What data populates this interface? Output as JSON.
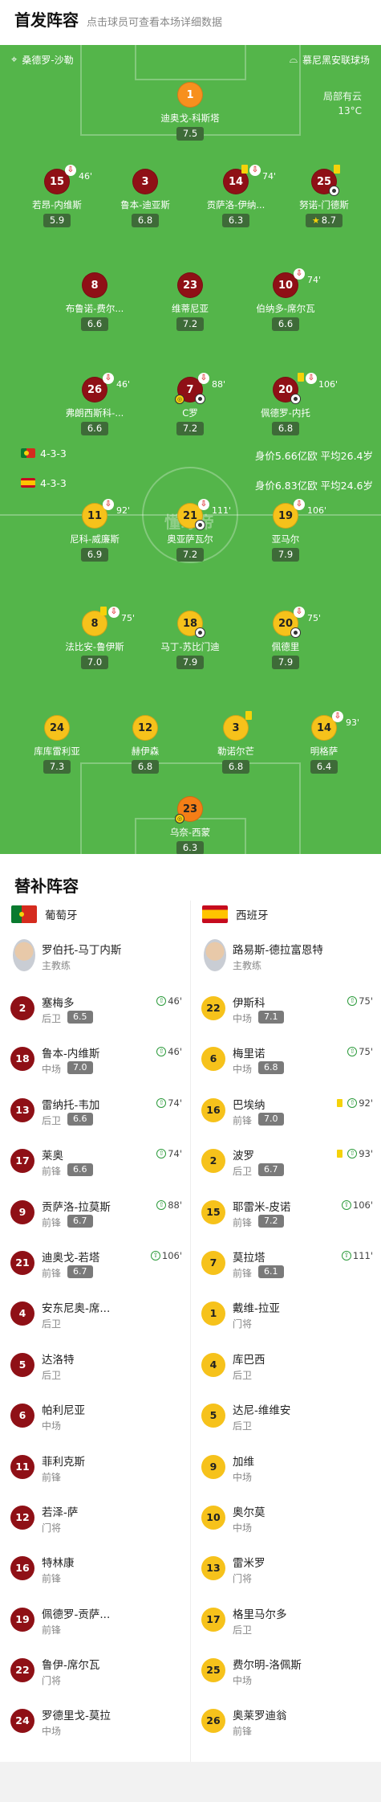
{
  "header": {
    "title": "首发阵容",
    "subtitle": "点击球员可查看本场详细数据"
  },
  "pitch": {
    "referee_label": "桑德罗-沙勒",
    "stadium_label": "慕尼黑安联球场",
    "weather": "局部有云",
    "temperature": "13°C",
    "watermark": "懂球帝",
    "portugal": {
      "formation": "4-3-3",
      "value": "身价5.66亿欧  平均26.4岁"
    },
    "spain": {
      "formation": "4-3-3",
      "value": "身价6.83亿欧  平均24.6岁"
    }
  },
  "portugal_players": [
    {
      "num": "1",
      "name": "迪奥戈-科斯塔",
      "rating": "7.5"
    },
    {
      "num": "15",
      "name": "若昂-内维斯",
      "rating": "5.9",
      "sub": "46'"
    },
    {
      "num": "3",
      "name": "鲁本-迪亚斯",
      "rating": "6.8"
    },
    {
      "num": "14",
      "name": "贡萨洛-伊纳...",
      "rating": "6.3",
      "sub": "74'"
    },
    {
      "num": "25",
      "name": "努诺-门德斯",
      "rating": "8.7"
    },
    {
      "num": "8",
      "name": "布鲁诺-费尔...",
      "rating": "6.6"
    },
    {
      "num": "23",
      "name": "维蒂尼亚",
      "rating": "7.2"
    },
    {
      "num": "10",
      "name": "伯纳多-席尔瓦",
      "rating": "6.6",
      "sub": "74'"
    },
    {
      "num": "26",
      "name": "弗朗西斯科-...",
      "rating": "6.6",
      "sub": "46'"
    },
    {
      "num": "7",
      "name": "C罗",
      "rating": "7.2",
      "sub": "88'"
    },
    {
      "num": "20",
      "name": "佩德罗-内托",
      "rating": "6.8",
      "sub": "106'"
    }
  ],
  "spain_players": [
    {
      "num": "11",
      "name": "尼科-威廉斯",
      "rating": "6.9",
      "sub": "92'"
    },
    {
      "num": "21",
      "name": "奥亚萨瓦尔",
      "rating": "7.2",
      "sub": "111'"
    },
    {
      "num": "19",
      "name": "亚马尔",
      "rating": "7.9",
      "sub": "106'"
    },
    {
      "num": "8",
      "name": "法比安-鲁伊斯",
      "rating": "7.0",
      "sub": "75'"
    },
    {
      "num": "18",
      "name": "马丁-苏比门迪",
      "rating": "7.9"
    },
    {
      "num": "20",
      "name": "佩德里",
      "rating": "7.9",
      "sub": "75'"
    },
    {
      "num": "24",
      "name": "库库雷利亚",
      "rating": "7.3"
    },
    {
      "num": "12",
      "name": "赫伊森",
      "rating": "6.8"
    },
    {
      "num": "3",
      "name": "勒诺尔芒",
      "rating": "6.8"
    },
    {
      "num": "14",
      "name": "明格萨",
      "rating": "6.4",
      "sub": "93'"
    },
    {
      "num": "23",
      "name": "乌奈-西蒙",
      "rating": "6.3"
    }
  ],
  "subs_section": {
    "title": "替补阵容",
    "portugal": {
      "team": "葡萄牙",
      "coach": {
        "name": "罗伯托-马丁内斯",
        "role": "主教练"
      },
      "subs": [
        {
          "num": "2",
          "name": "塞梅多",
          "pos": "后卫",
          "rating": "6.5",
          "in": "46'"
        },
        {
          "num": "18",
          "name": "鲁本-内维斯",
          "pos": "中场",
          "rating": "7.0",
          "in": "46'"
        },
        {
          "num": "13",
          "name": "雷纳托-韦加",
          "pos": "后卫",
          "rating": "6.6",
          "in": "74'"
        },
        {
          "num": "17",
          "name": "莱奥",
          "pos": "前锋",
          "rating": "6.6",
          "in": "74'"
        },
        {
          "num": "9",
          "name": "贡萨洛-拉莫斯",
          "pos": "前锋",
          "rating": "6.7",
          "in": "88'"
        },
        {
          "num": "21",
          "name": "迪奥戈-若塔",
          "pos": "前锋",
          "rating": "6.7",
          "in": "106'"
        },
        {
          "num": "4",
          "name": "安东尼奥-席...",
          "pos": "后卫"
        },
        {
          "num": "5",
          "name": "达洛特",
          "pos": "后卫"
        },
        {
          "num": "6",
          "name": "帕利尼亚",
          "pos": "中场"
        },
        {
          "num": "11",
          "name": "菲利克斯",
          "pos": "前锋"
        },
        {
          "num": "12",
          "name": "若泽-萨",
          "pos": "门将"
        },
        {
          "num": "16",
          "name": "特林康",
          "pos": "前锋"
        },
        {
          "num": "19",
          "name": "佩德罗-贡萨...",
          "pos": "前锋"
        },
        {
          "num": "22",
          "name": "鲁伊-席尔瓦",
          "pos": "门将"
        },
        {
          "num": "24",
          "name": "罗德里戈-莫拉",
          "pos": "中场"
        }
      ]
    },
    "spain": {
      "team": "西班牙",
      "coach": {
        "name": "路易斯-德拉富恩特",
        "role": "主教练"
      },
      "subs": [
        {
          "num": "22",
          "name": "伊斯科",
          "pos": "中场",
          "rating": "7.1",
          "in": "75'"
        },
        {
          "num": "6",
          "name": "梅里诺",
          "pos": "中场",
          "rating": "6.8",
          "in": "75'"
        },
        {
          "num": "16",
          "name": "巴埃纳",
          "pos": "前锋",
          "rating": "7.0",
          "in": "92'",
          "card": true
        },
        {
          "num": "2",
          "name": "波罗",
          "pos": "后卫",
          "rating": "6.7",
          "in": "93'",
          "card": true
        },
        {
          "num": "15",
          "name": "耶雷米-皮诺",
          "pos": "前锋",
          "rating": "7.2",
          "in": "106'"
        },
        {
          "num": "7",
          "name": "莫拉塔",
          "pos": "前锋",
          "rating": "6.1",
          "in": "111'"
        },
        {
          "num": "1",
          "name": "戴维-拉亚",
          "pos": "门将"
        },
        {
          "num": "4",
          "name": "库巴西",
          "pos": "后卫"
        },
        {
          "num": "5",
          "name": "达尼-维维安",
          "pos": "后卫"
        },
        {
          "num": "9",
          "name": "加维",
          "pos": "中场"
        },
        {
          "num": "10",
          "name": "奥尔莫",
          "pos": "中场"
        },
        {
          "num": "13",
          "name": "雷米罗",
          "pos": "门将"
        },
        {
          "num": "17",
          "name": "格里马尔多",
          "pos": "后卫"
        },
        {
          "num": "25",
          "name": "费尔明-洛佩斯",
          "pos": "中场"
        },
        {
          "num": "26",
          "name": "奥莱罗迪翁",
          "pos": "前锋"
        }
      ]
    }
  },
  "colors": {
    "pitch": "#54b54a",
    "portugal": "#8f1016",
    "spain": "#f6c21b",
    "goalkeeper": "#f7901e"
  }
}
